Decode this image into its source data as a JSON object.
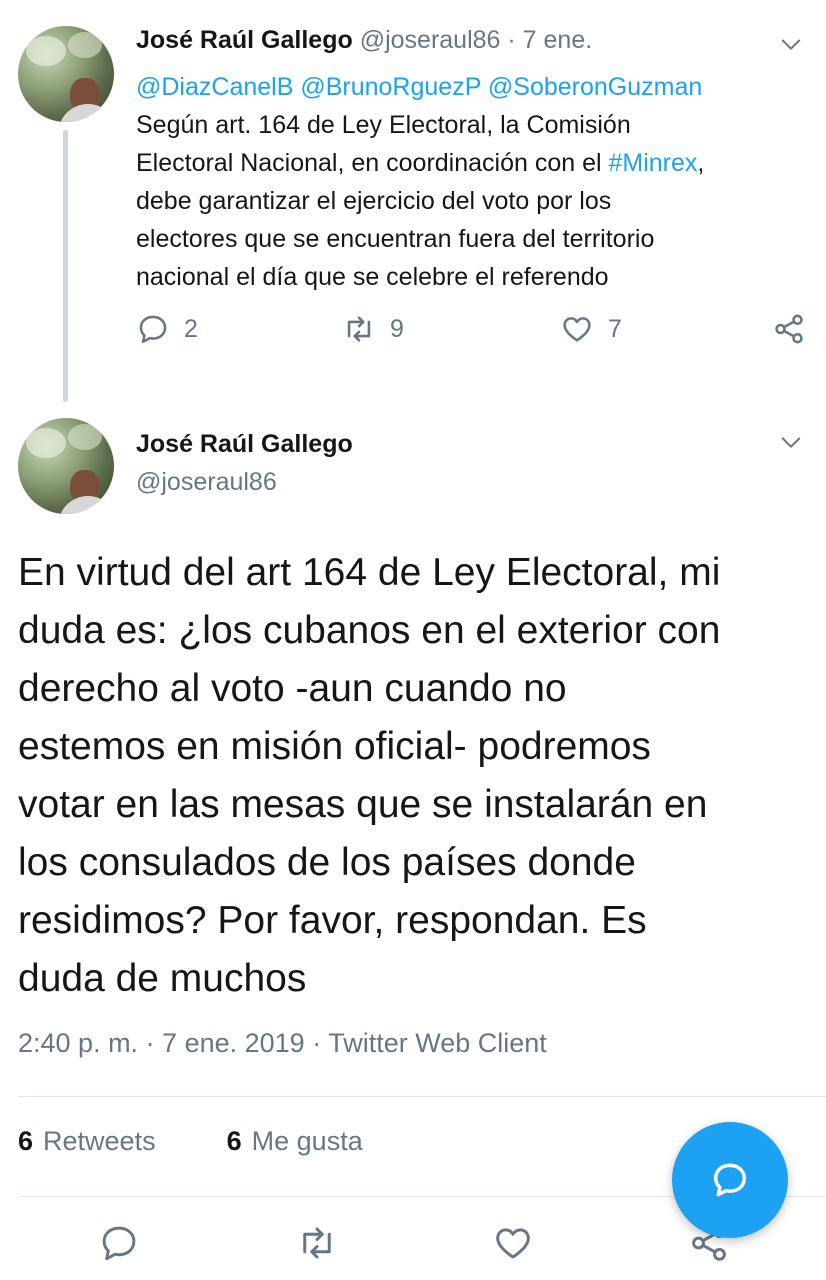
{
  "parent_tweet": {
    "author_name": "José Raúl Gallego",
    "author_handle": "@joseraul86",
    "time_sep": " · ",
    "time": "7 ene.",
    "mentions": [
      "@DiazCanelB",
      "@BrunoRguezP",
      "@SoberonGuzman"
    ],
    "body_line1_prefix": "Según art. 164 de Ley Electoral, la Comisión",
    "body_line2_prefix": "Electoral Nacional, en coordinación con el ",
    "hashtag": "#Minrex",
    "body_line2_suffix": ",",
    "body_line3": "debe garantizar el ejercicio del voto por los",
    "body_line4": "electores que se encuentran fuera del territorio",
    "body_line5": "nacional el día que se celebre el referendo",
    "replies": "2",
    "retweets": "9",
    "likes": "7"
  },
  "main_tweet": {
    "author_name": "José Raúl Gallego",
    "author_handle": "@joseraul86",
    "body_lines": [
      "En virtud del art 164 de Ley Electoral, mi",
      "duda es: ¿los cubanos en el exterior con",
      "derecho al voto -aun cuando no",
      "estemos en misión oficial- podremos",
      "votar en las mesas que se instalarán en",
      "los consulados de los países donde",
      "residimos? Por favor, respondan. Es",
      "duda de muchos"
    ],
    "meta": "2:40 p. m. · 7 ene. 2019 · Twitter Web Client",
    "retweet_count": "6",
    "retweet_label": "Retweets",
    "like_count": "6",
    "like_label": "Me gusta"
  },
  "icons": {
    "reply": "reply-icon",
    "retweet": "retweet-icon",
    "like": "heart-icon",
    "share": "share-icon",
    "more": "chevron-down-icon",
    "compose": "compose-reply-icon"
  },
  "colors": {
    "accent": "#1da1f2",
    "muted": "#657786",
    "text": "#14171a",
    "thread_line": "#ccd6dd"
  }
}
